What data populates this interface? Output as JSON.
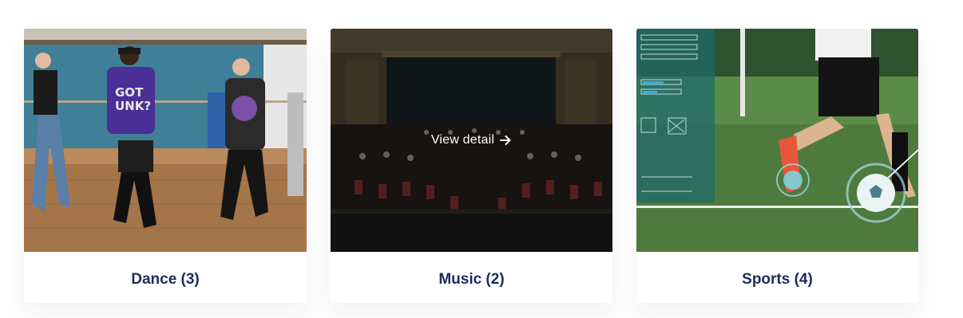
{
  "categories": [
    {
      "label": "Dance (3)",
      "image": "dance-photo"
    },
    {
      "label": "Music (2)",
      "image": "orchestra-photo",
      "hover_action": "View detail"
    },
    {
      "label": "Sports (4)",
      "image": "soccer-player-photo"
    }
  ],
  "colors": {
    "caption_text": "#1f2a5c",
    "overlay": "#080a0c",
    "card_background": "#ffffff"
  },
  "icons": {
    "view_detail": "arrow-right-icon"
  }
}
